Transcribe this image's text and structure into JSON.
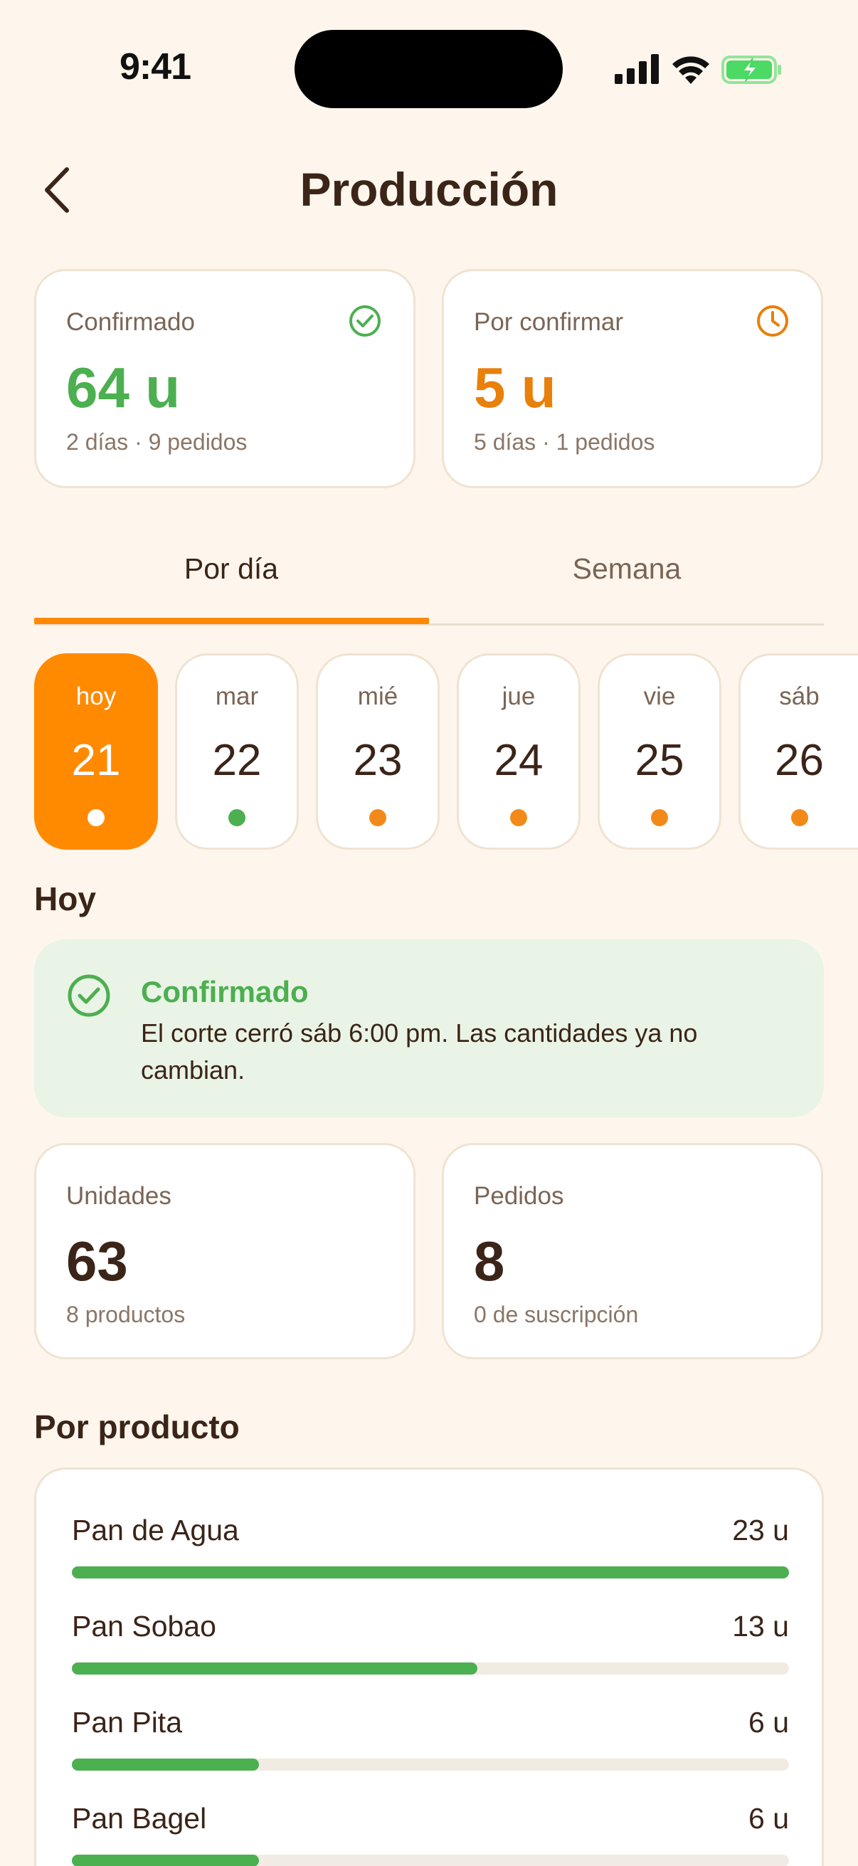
{
  "status_bar": {
    "time": "9:41"
  },
  "header": {
    "title": "Producción"
  },
  "summary": {
    "confirmed": {
      "label": "Confirmado",
      "value": "64 u",
      "sub": "2 días · 9 pedidos",
      "icon": "check-circle-icon",
      "color": "#4CAF50"
    },
    "pending": {
      "label": "Por confirmar",
      "value": "5 u",
      "sub": "5 días · 1 pedidos",
      "icon": "clock-icon",
      "color": "#E8800A"
    }
  },
  "tabs": [
    {
      "label": "Por día",
      "active": true
    },
    {
      "label": "Semana",
      "active": false
    }
  ],
  "days": [
    {
      "name": "hoy",
      "num": "21",
      "status": "active",
      "dot_color": "#FFFFFF"
    },
    {
      "name": "mar",
      "num": "22",
      "status": "confirmed",
      "dot_color": "#4CAF50"
    },
    {
      "name": "mié",
      "num": "23",
      "status": "pending",
      "dot_color": "#F28A1A"
    },
    {
      "name": "jue",
      "num": "24",
      "status": "pending",
      "dot_color": "#F28A1A"
    },
    {
      "name": "vie",
      "num": "25",
      "status": "pending",
      "dot_color": "#F28A1A"
    },
    {
      "name": "sáb",
      "num": "26",
      "status": "pending",
      "dot_color": "#F28A1A"
    }
  ],
  "today": {
    "section_title": "Hoy",
    "banner": {
      "title": "Confirmado",
      "text": "El corte cerró sáb 6:00 pm. Las cantidades ya no cambian."
    },
    "units": {
      "label": "Unidades",
      "value": "63",
      "sub": "8 productos"
    },
    "orders": {
      "label": "Pedidos",
      "value": "8",
      "sub": "0 de suscripción"
    }
  },
  "products": {
    "section_title": "Por producto",
    "items": [
      {
        "name": "Pan de Agua",
        "qty": "23 u",
        "fraction": 1.0
      },
      {
        "name": "Pan Sobao",
        "qty": "13 u",
        "fraction": 0.565
      },
      {
        "name": "Pan Pita",
        "qty": "6 u",
        "fraction": 0.261
      },
      {
        "name": "Pan Bagel",
        "qty": "6 u",
        "fraction": 0.261
      }
    ]
  },
  "colors": {
    "accent": "#FF8A00",
    "success": "#4CAF50",
    "background": "#FEF6EC"
  }
}
